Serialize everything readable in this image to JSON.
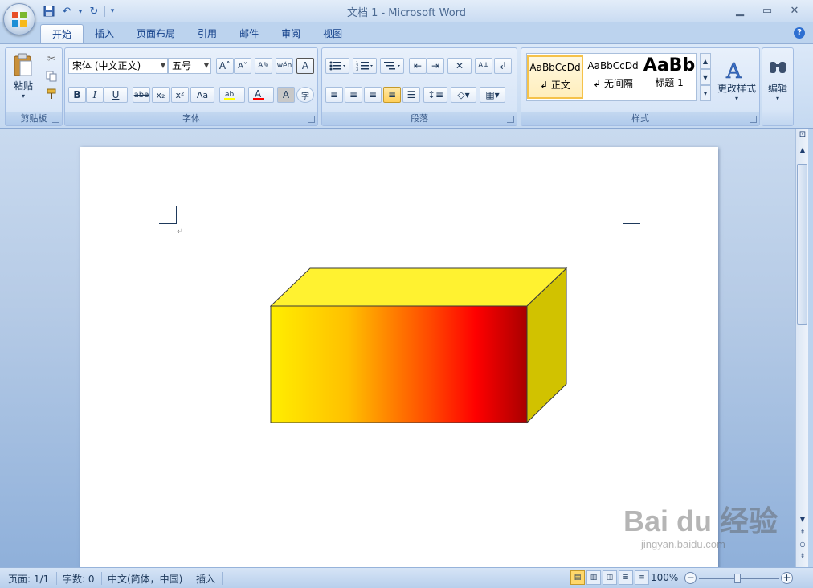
{
  "window": {
    "title": "文档 1 - Microsoft Word",
    "minimize": "▁",
    "maximize": "▭",
    "close": "✕"
  },
  "ribbon_tabs": [
    "开始",
    "插入",
    "页面布局",
    "引用",
    "邮件",
    "审阅",
    "视图"
  ],
  "clipboard": {
    "paste_label": "粘贴",
    "group_label": "剪贴板"
  },
  "font": {
    "font_name": "宋体 (中文正文)",
    "font_size": "五号",
    "group_label": "字体",
    "bold": "B",
    "italic": "I",
    "underline": "U",
    "strikethrough": "abe",
    "subscript": "x₂",
    "superscript": "x²",
    "change_case": "Aa",
    "grow": "A˄",
    "shrink": "A˅",
    "wen": "wén",
    "char_border": "A",
    "char_shading": "A",
    "enclose": "字"
  },
  "paragraph": {
    "group_label": "段落"
  },
  "styles": {
    "group_label": "样式",
    "items": [
      {
        "preview": "AaBbCcDd",
        "name": "↲ 正文"
      },
      {
        "preview": "AaBbCcDd",
        "name": "↲ 无间隔"
      },
      {
        "preview": "AaBb",
        "name": "标题 1"
      }
    ],
    "change_styles_label": "更改样式"
  },
  "editing": {
    "label": "编辑"
  },
  "document": {
    "paragraph_mark": "↵"
  },
  "shape": {
    "type": "3D box",
    "top_color": "#fff230",
    "side_color": "#d1c200",
    "front_gradient": [
      "#ffee00",
      "#ff6000",
      "#ff0000",
      "#b00000"
    ]
  },
  "watermark": {
    "big": "Bai du 经验",
    "small": "jingyan.baidu.com"
  },
  "statusbar": {
    "page": "页面: 1/1",
    "words": "字数: 0",
    "language": "中文(简体，中国)",
    "mode": "插入",
    "zoom": "100%"
  },
  "colors": {
    "highlight": "#ffff00",
    "font_color": "#ff0000"
  }
}
